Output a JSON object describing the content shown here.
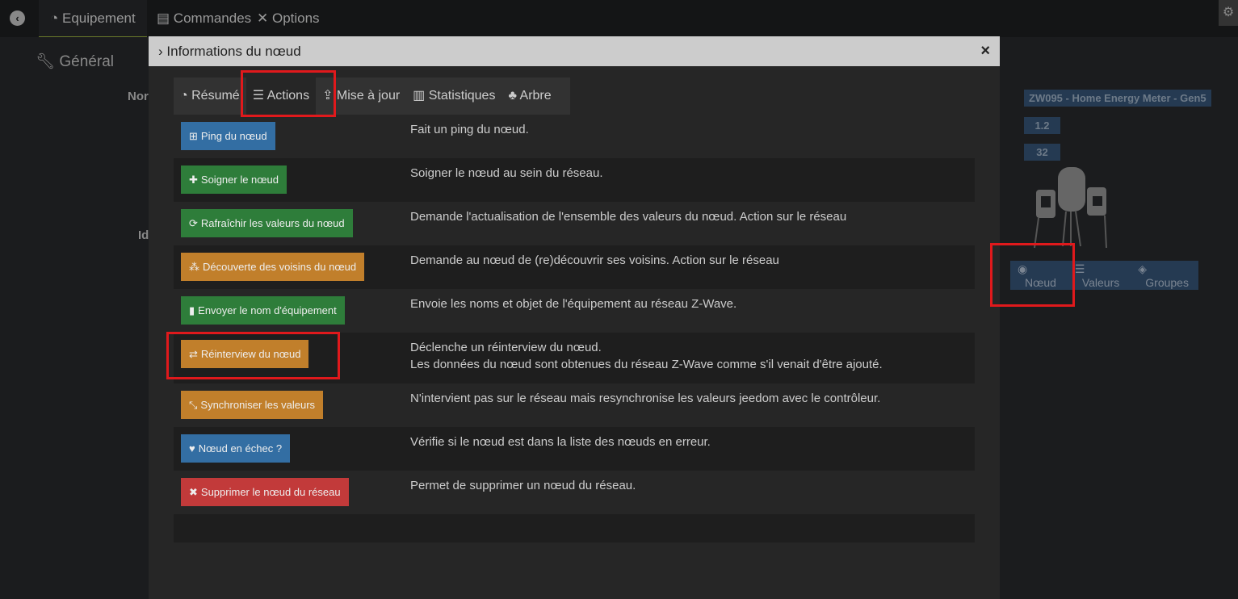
{
  "topbar": {
    "tabs": [
      {
        "label": "Equipement",
        "icon": "dashboard-icon"
      },
      {
        "label": "Commandes",
        "icon": "list-icon"
      },
      {
        "label": "Options",
        "icon": "tools-icon"
      }
    ]
  },
  "general": {
    "title": "Général",
    "label_name": "Nor",
    "label_id": "Id"
  },
  "right_panel": {
    "model": "ZW095 - Home Energy Meter - Gen5",
    "version": "1.2",
    "node_id": "32",
    "tabs": [
      "Nœud",
      "Valeurs",
      "Groupes"
    ]
  },
  "modal": {
    "title": "Informations du nœud",
    "close": "×",
    "tabs": [
      {
        "label": "Résumé",
        "icon": "dashboard-icon"
      },
      {
        "label": "Actions",
        "icon": "sliders-icon"
      },
      {
        "label": "Mise à jour",
        "icon": "update-icon"
      },
      {
        "label": "Statistiques",
        "icon": "bar-chart-icon"
      },
      {
        "label": "Arbre",
        "icon": "tree-icon"
      }
    ],
    "actions": [
      {
        "label": "Ping du nœud",
        "icon": "⊞",
        "color": "blue",
        "desc": [
          "Fait un ping du nœud."
        ]
      },
      {
        "label": "Soigner le nœud",
        "icon": "✚",
        "color": "green",
        "desc": [
          "Soigner le nœud au sein du réseau."
        ]
      },
      {
        "label": "Rafraîchir les valeurs du nœud",
        "icon": "⟳",
        "color": "green",
        "desc": [
          "Demande l'actualisation de l'ensemble des valeurs du nœud. Action sur le réseau"
        ]
      },
      {
        "label": "Découverte des voisins du nœud",
        "icon": "⁂",
        "color": "orange",
        "desc": [
          "Demande au nœud de (re)découvrir ses voisins. Action sur le réseau"
        ]
      },
      {
        "label": "Envoyer le nom d'équipement",
        "icon": "▮",
        "color": "green",
        "desc": [
          "Envoie les noms et objet de l'équipement au réseau Z-Wave."
        ]
      },
      {
        "label": "Réinterview du nœud",
        "icon": "⇄",
        "color": "orange",
        "desc": [
          "Déclenche un réinterview du nœud.",
          "Les données du nœud sont obtenues du réseau Z-Wave comme s'il venait d'être ajouté."
        ]
      },
      {
        "label": "Synchroniser les valeurs",
        "icon": "⤡",
        "color": "orange",
        "desc": [
          "N'intervient pas sur le réseau mais resynchronise les valeurs jeedom avec le contrôleur."
        ]
      },
      {
        "label": "Nœud en échec ?",
        "icon": "♥",
        "color": "blue",
        "desc": [
          "Vérifie si le nœud est dans la liste des nœuds en erreur."
        ]
      },
      {
        "label": "Supprimer le nœud du réseau",
        "icon": "✖",
        "color": "red",
        "desc": [
          "Permet de supprimer un nœud du réseau."
        ]
      }
    ]
  }
}
